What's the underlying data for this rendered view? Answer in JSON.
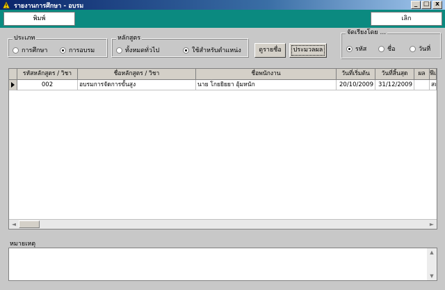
{
  "window": {
    "title": "รายงานการศึกษา - อบรม",
    "minimize": "_",
    "maximize": "□",
    "close": "x"
  },
  "toolbar": {
    "print_label": "พิมพ์",
    "cancel_label": "เลิก"
  },
  "type_group": {
    "legend": "ประเภท",
    "options": [
      "การศึกษา",
      "การอบรม"
    ],
    "selected": 1
  },
  "course_group": {
    "legend": "หลักสูตร",
    "options": [
      "ทั้งหมดทั่วไป",
      "ใช้สำหรับตำแหน่ง"
    ],
    "selected": 1
  },
  "actions": {
    "view_list": "ดูรายชื่อ",
    "evaluate": "ประมวลผล"
  },
  "sort_group": {
    "legend": "จัดเรียงโดย ...",
    "options": [
      "รหัส",
      "ชื่อ",
      "วันที่"
    ],
    "selected": 0
  },
  "grid": {
    "columns": [
      "รหัสหลักสูตร / วิชา",
      "ชื่อหลักสูตร / วิชา",
      "ชื่อพนักงาน",
      "วันที่เริ่มต้น",
      "วันที่สิ้นสุด",
      "ผล",
      "ฟีเ"
    ],
    "rows": [
      [
        "002",
        "อบรมการจัดการขั้นสูง",
        "นาย โกยยิยยา อุ้มหนัก",
        "20/10/2009",
        "31/12/2009",
        "",
        "สถ"
      ]
    ]
  },
  "note": {
    "label": "หมายเหตุ",
    "value": ""
  }
}
